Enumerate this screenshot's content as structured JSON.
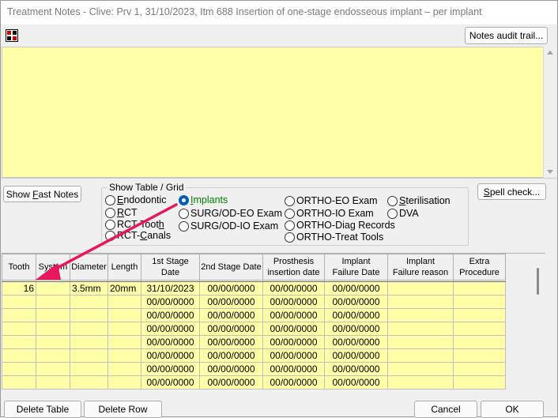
{
  "window": {
    "title": "Treatment Notes - Clive: Prv 1, 31/10/2023, Itm 688 Insertion of one-stage endosseous implant – per implant"
  },
  "toolbar": {
    "notes_audit_label": "Notes audit trail..."
  },
  "notes": {
    "text": ""
  },
  "buttons": {
    "show_fast_notes_pre": "Show ",
    "show_fast_notes_key": "F",
    "show_fast_notes_post": "ast Notes",
    "spell_check_key": "S",
    "spell_check_post": "pell check...",
    "delete_table": "Delete Table",
    "delete_row": "Delete Row",
    "cancel": "Cancel",
    "ok": "OK"
  },
  "show_table": {
    "label": "Show Table / Grid",
    "options": [
      {
        "id": "endodontic",
        "pre": "",
        "key": "E",
        "post": "ndodontic",
        "selected": false
      },
      {
        "id": "rct",
        "pre": "",
        "key": "R",
        "post": "CT",
        "selected": false
      },
      {
        "id": "rct-tooth",
        "pre": "RCT-Toot",
        "key": "h",
        "post": "",
        "selected": false
      },
      {
        "id": "rct-canals",
        "pre": "RCT-",
        "key": "C",
        "post": "anals",
        "selected": false
      },
      {
        "id": "implants",
        "pre": "",
        "key": "I",
        "post": "mplants",
        "selected": true
      },
      {
        "id": "surg-od-eo",
        "pre": "SURG/OD-EO Exam",
        "key": "",
        "post": "",
        "selected": false
      },
      {
        "id": "surg-od-io",
        "pre": "SURG/OD-IO Exam",
        "key": "",
        "post": "",
        "selected": false
      },
      {
        "id": "ortho-eo",
        "pre": "ORTHO-EO Exam",
        "key": "",
        "post": "",
        "selected": false
      },
      {
        "id": "ortho-io",
        "pre": "ORTHO-IO Exam",
        "key": "",
        "post": "",
        "selected": false
      },
      {
        "id": "ortho-diag",
        "pre": "ORTHO-Diag Records",
        "key": "",
        "post": "",
        "selected": false
      },
      {
        "id": "ortho-treat",
        "pre": "ORTHO-Treat Tools",
        "key": "",
        "post": "",
        "selected": false
      },
      {
        "id": "sterilisation",
        "pre": "",
        "key": "S",
        "post": "terilisation",
        "selected": false
      },
      {
        "id": "dva",
        "pre": "DVA",
        "key": "",
        "post": "",
        "selected": false
      }
    ]
  },
  "grid": {
    "headers": [
      [
        "Tooth"
      ],
      [
        "System"
      ],
      [
        "Diameter"
      ],
      [
        "Length"
      ],
      [
        "1st Stage Date"
      ],
      [
        "2nd Stage Date"
      ],
      [
        "Prosthesis",
        "insertion date"
      ],
      [
        "Implant",
        "Failure Date"
      ],
      [
        "Implant",
        "Failure reason"
      ],
      [
        "Extra",
        "Procedure"
      ]
    ],
    "rows": [
      [
        "16",
        "",
        "3.5mm",
        "20mm",
        "31/10/2023",
        "00/00/0000",
        "00/00/0000",
        "00/00/0000",
        "",
        ""
      ],
      [
        "",
        "",
        "",
        "",
        "00/00/0000",
        "00/00/0000",
        "00/00/0000",
        "00/00/0000",
        "",
        ""
      ],
      [
        "",
        "",
        "",
        "",
        "00/00/0000",
        "00/00/0000",
        "00/00/0000",
        "00/00/0000",
        "",
        ""
      ],
      [
        "",
        "",
        "",
        "",
        "00/00/0000",
        "00/00/0000",
        "00/00/0000",
        "00/00/0000",
        "",
        ""
      ],
      [
        "",
        "",
        "",
        "",
        "00/00/0000",
        "00/00/0000",
        "00/00/0000",
        "00/00/0000",
        "",
        ""
      ],
      [
        "",
        "",
        "",
        "",
        "00/00/0000",
        "00/00/0000",
        "00/00/0000",
        "00/00/0000",
        "",
        ""
      ],
      [
        "",
        "",
        "",
        "",
        "00/00/0000",
        "00/00/0000",
        "00/00/0000",
        "00/00/0000",
        "",
        ""
      ],
      [
        "",
        "",
        "",
        "",
        "00/00/0000",
        "00/00/0000",
        "00/00/0000",
        "00/00/0000",
        "",
        ""
      ]
    ]
  },
  "annotation": {
    "color": "#e8175d"
  },
  "colors": {
    "notes_bg": "#ffffa8",
    "selected_radio": "#005fb8",
    "selected_label": "#008000"
  }
}
